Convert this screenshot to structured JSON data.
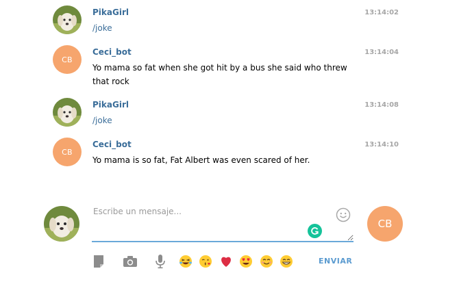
{
  "messages": [
    {
      "sender": "PikaGirl",
      "time": "13:14:02",
      "text": "/joke",
      "avatar": "puppy-photo"
    },
    {
      "sender": "Ceci_bot",
      "time": "13:14:04",
      "text": "Yo mama so fat when she got hit by a bus she said who threw that rock",
      "avatar_initials": "CB"
    },
    {
      "sender": "PikaGirl",
      "time": "13:14:08",
      "text": "/joke",
      "avatar": "puppy-photo"
    },
    {
      "sender": "Ceci_bot",
      "time": "13:14:10",
      "text": "Yo mama is so fat, Fat Albert was even scared of her.",
      "avatar_initials": "CB"
    }
  ],
  "composer": {
    "placeholder": "Escribe un mensaje...",
    "bot_initials": "CB",
    "send_label": "ENVIAR"
  },
  "toolbar": {
    "icons": [
      "document-icon",
      "camera-icon",
      "microphone-icon"
    ],
    "emojis": [
      "laughing-tears-emoji",
      "kissing-emoji",
      "red-heart-emoji",
      "heart-eyes-emoji",
      "smiling-emoji",
      "grinning-emoji"
    ]
  },
  "colors": {
    "sender": "#3a6d99",
    "avatar_bg": "#f6a56d",
    "input_underline": "#6aa8d9",
    "send": "#5b9bd0",
    "grammarly": "#15c39a"
  }
}
